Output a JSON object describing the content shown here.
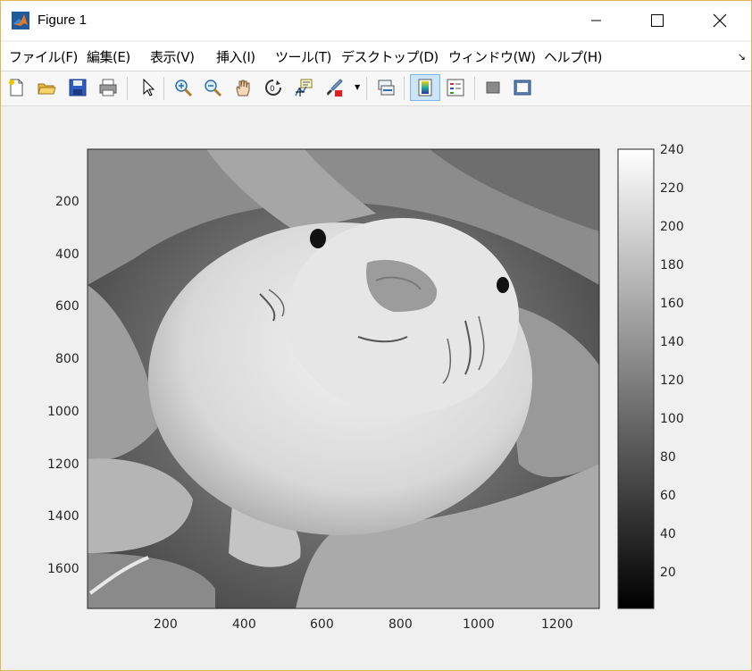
{
  "window": {
    "title": "Figure 1"
  },
  "menu": {
    "items": [
      "ファイル(F)",
      "編集(E)",
      "表示(V)",
      "挿入(I)",
      "ツール(T)",
      "デスクトップ(D)",
      "ウィンドウ(W)",
      "ヘルプ(H)"
    ]
  },
  "toolbar": {
    "icons": [
      "new-figure-icon",
      "open-file-icon",
      "save-icon",
      "print-icon",
      "edit-plot-pointer-icon",
      "zoom-in-icon",
      "zoom-out-icon",
      "pan-hand-icon",
      "rotate-3d-icon",
      "data-cursor-icon",
      "brush-icon",
      "link-plot-icon",
      "insert-colorbar-icon",
      "insert-legend-icon",
      "hide-plot-tools-icon",
      "show-plot-tools-icon"
    ]
  },
  "image": {
    "description_label": "grayscale image",
    "x_ticks": [
      "200",
      "400",
      "600",
      "800",
      "1000",
      "1200"
    ],
    "y_ticks": [
      "200",
      "400",
      "600",
      "800",
      "1000",
      "1200",
      "1400",
      "1600"
    ]
  },
  "colorbar": {
    "ticks": [
      "240",
      "220",
      "200",
      "180",
      "160",
      "140",
      "120",
      "100",
      "80",
      "60",
      "40",
      "20"
    ],
    "range": [
      0,
      250
    ],
    "colormap": "gray"
  },
  "colors": {
    "accent_border": "#e0b65a"
  }
}
